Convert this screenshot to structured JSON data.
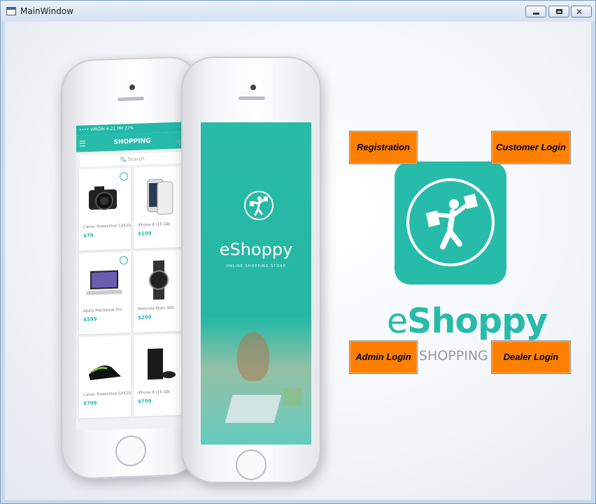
{
  "window": {
    "title": "MainWindow"
  },
  "buttons": {
    "registration": "Registration",
    "customer_login": "Customer Login",
    "admin_login": "Admin Login",
    "dealer_login": "Dealer Login",
    "color": "#ff8000"
  },
  "brand": {
    "name_e": "e",
    "name_rest": "Shoppy",
    "subtitle": "SHOPPING S",
    "color": "#27bba9"
  },
  "phone_left": {
    "status": "•••• VIRGIN  4:21 PM  22%",
    "header": "SHOPPING",
    "search_placeholder": "Search",
    "products": [
      {
        "name": "Canon PowerShot SX520",
        "price": "$79"
      },
      {
        "name": "iPhone 6 (16 GB)",
        "price": "$199"
      },
      {
        "name": "Apply Mackbook Pro",
        "price": "$599"
      },
      {
        "name": "Motorola Moto 360",
        "price": "$299"
      },
      {
        "name": "Canon PowerShot SX520",
        "price": "$799"
      },
      {
        "name": "iPhone 6 (16 GB)",
        "price": "$799"
      }
    ]
  },
  "phone_right": {
    "brand": "eShoppy",
    "tagline": "ONLINE SHOPPING STORE"
  }
}
